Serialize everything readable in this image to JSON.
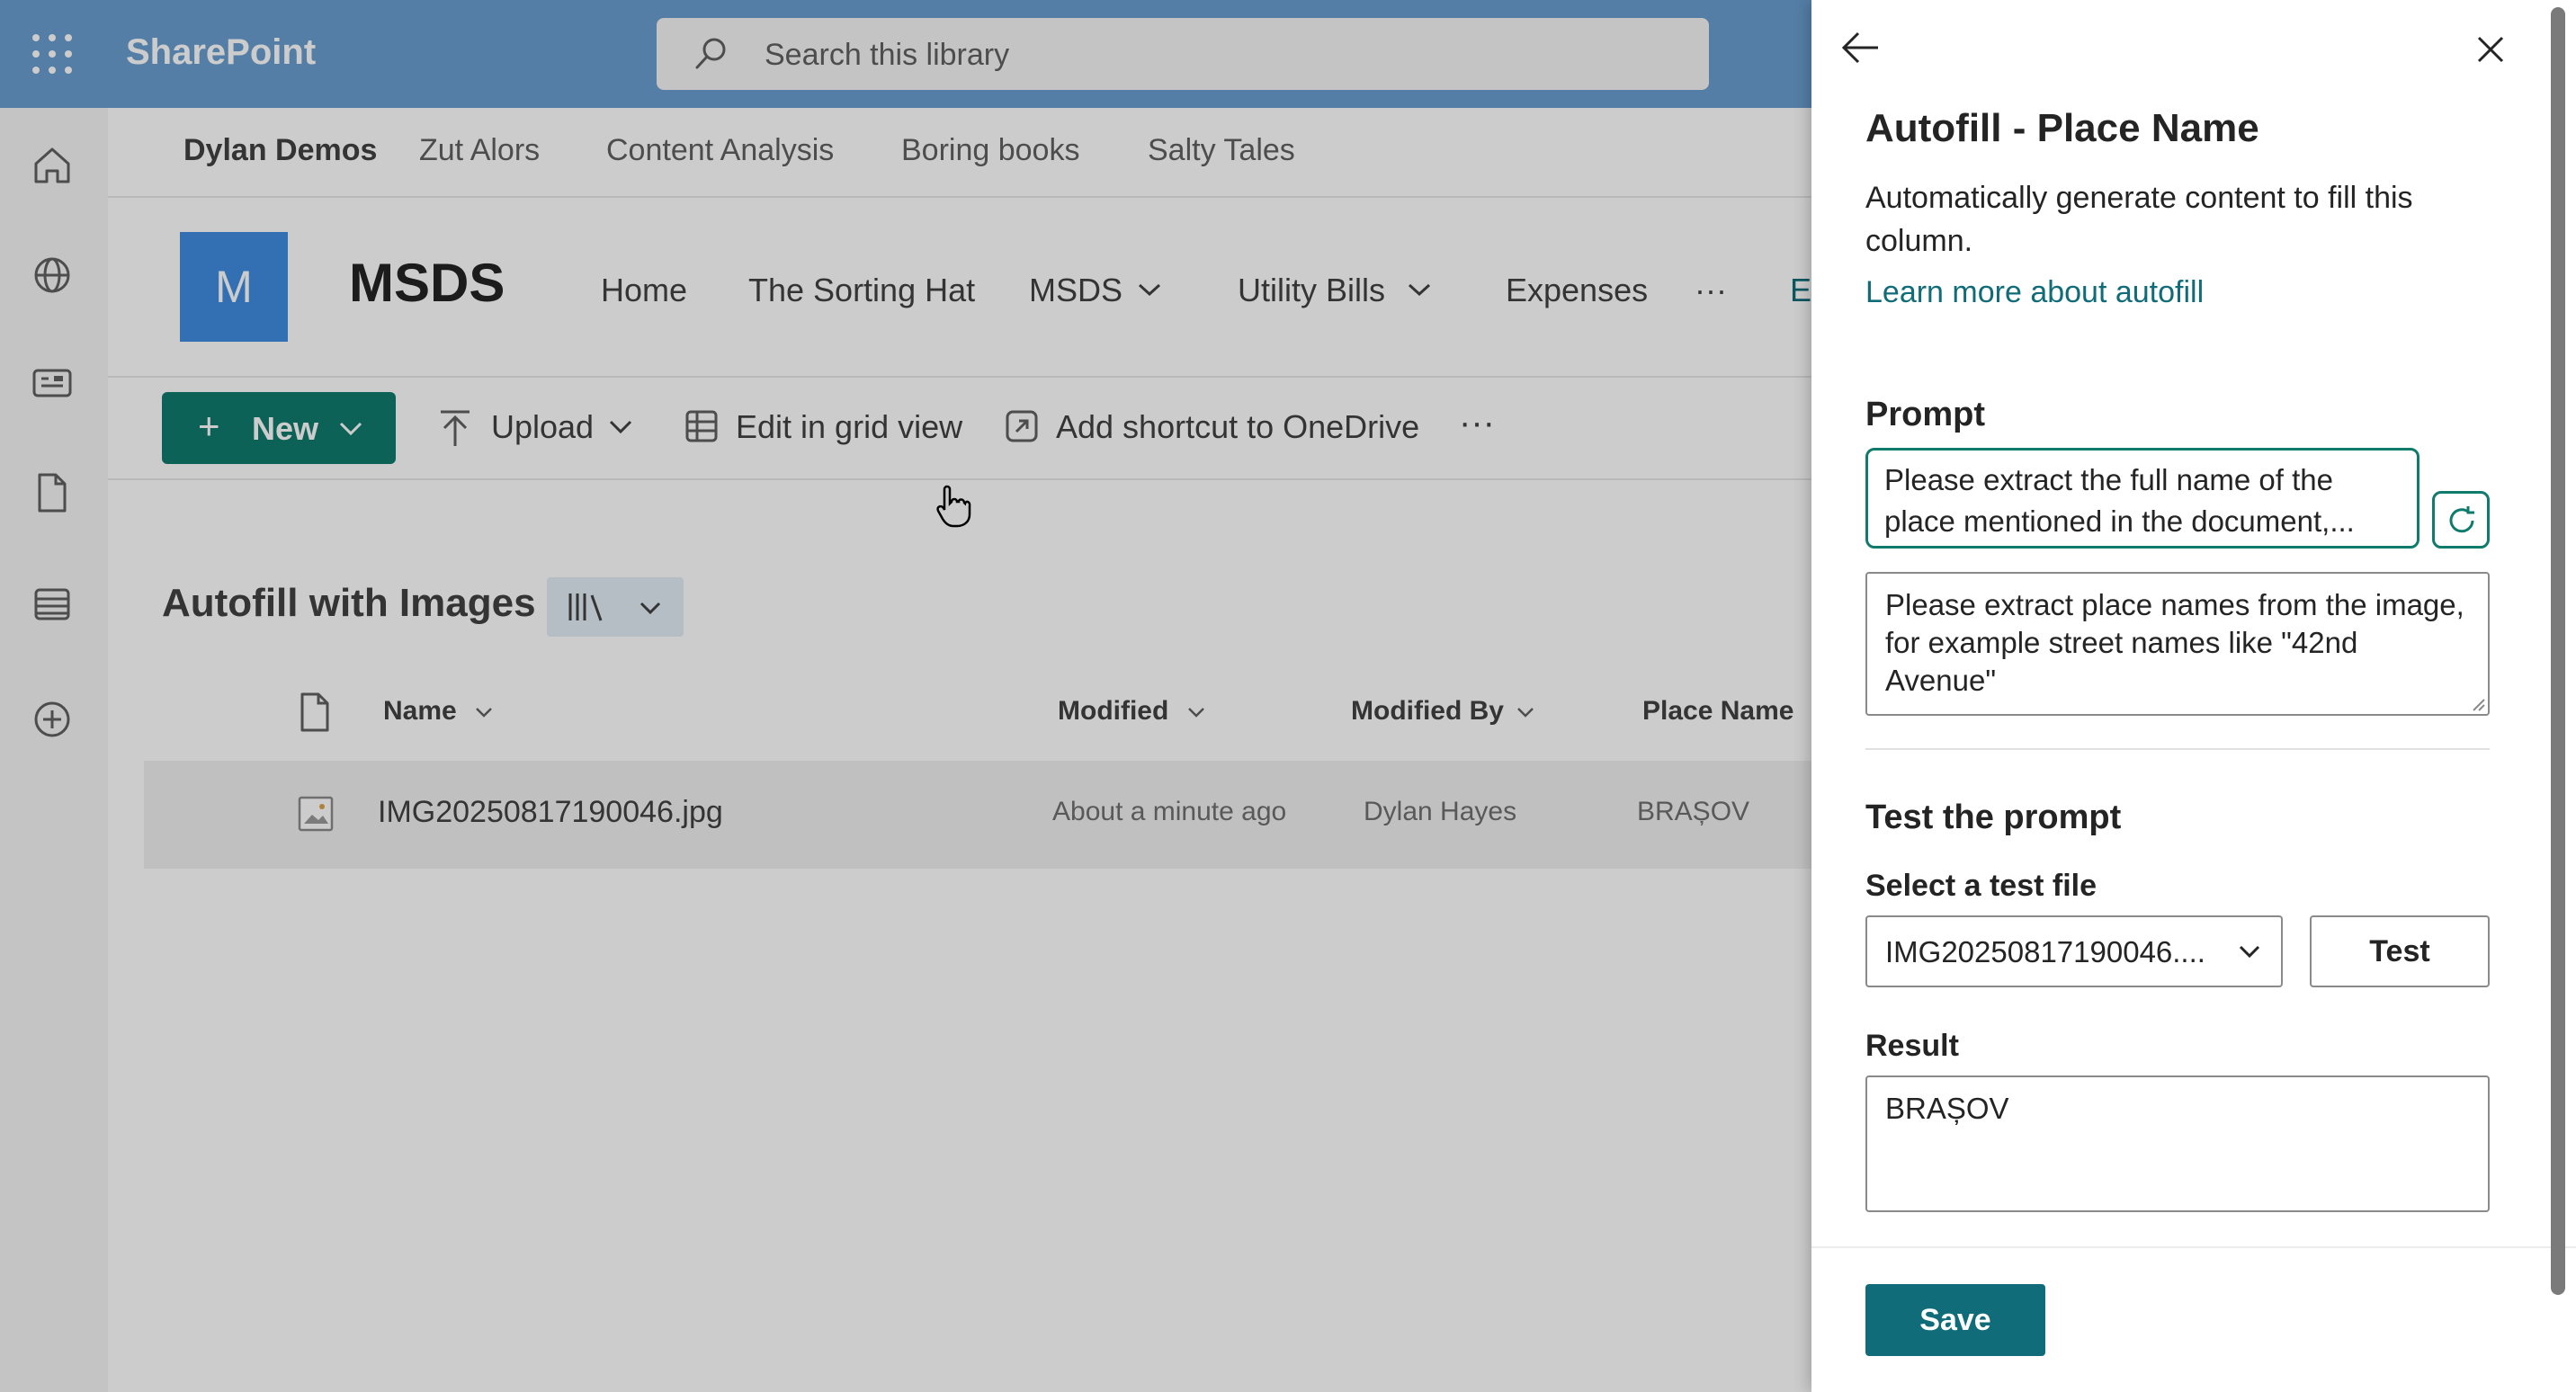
{
  "app": {
    "brand": "SharePoint"
  },
  "search": {
    "placeholder": "Search this library"
  },
  "hub_nav": [
    "Dylan Demos",
    "Zut Alors",
    "Content Analysis",
    "Boring books",
    "Salty Tales"
  ],
  "site": {
    "logo_letter": "M",
    "title": "MSDS",
    "nav": [
      "Home",
      "The Sorting Hat",
      "MSDS",
      "Utility Bills",
      "Expenses",
      "···",
      "E"
    ]
  },
  "command_bar": {
    "new": "New",
    "upload": "Upload",
    "edit_grid": "Edit in grid view",
    "shortcut": "Add shortcut to OneDrive",
    "more": "···"
  },
  "library": {
    "title": "Autofill with Images",
    "columns": {
      "name": "Name",
      "modified": "Modified",
      "modified_by": "Modified By",
      "place_name": "Place Name"
    },
    "rows": [
      {
        "name": "IMG20250817190046.jpg",
        "modified": "About a minute ago",
        "modified_by": "Dylan Hayes",
        "place_name": "BRAȘOV"
      }
    ]
  },
  "panel": {
    "title": "Autofill - Place Name",
    "description": "Automatically generate content to fill this column.",
    "learn_more": "Learn more about autofill",
    "prompt_label": "Prompt",
    "prompt_line1": "Please extract the full name of the",
    "prompt_line2": "place mentioned in the document,...",
    "prompt_text": "Please extract place names from the image, for example street names like \"42nd Avenue\"",
    "test_heading": "Test the prompt",
    "select_label": "Select a test file",
    "selected_file": "IMG20250817190046....",
    "test_button": "Test",
    "result_label": "Result",
    "result_value": "BRAȘOV",
    "save_button": "Save"
  },
  "colors": {
    "accent": "#0f7b6c",
    "header": "#6b9ed0",
    "logo": "#3f8ce0",
    "link": "#0f6c78"
  }
}
